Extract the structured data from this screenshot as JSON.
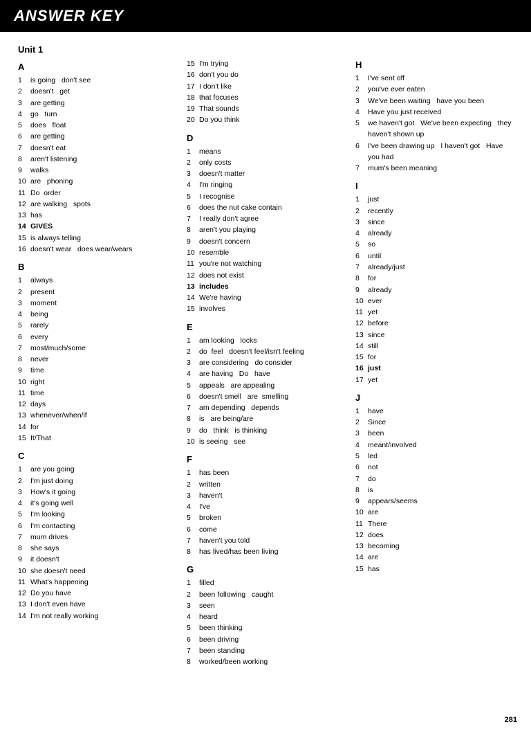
{
  "header": {
    "title": "ANSWER KEY"
  },
  "page_number": "281",
  "unit1": "Unit 1",
  "sections": {
    "A": {
      "label": "A",
      "items": [
        {
          "num": "1",
          "bold": false,
          "text": "is going   don't see"
        },
        {
          "num": "2",
          "bold": false,
          "text": "doesn't   get"
        },
        {
          "num": "3",
          "bold": false,
          "text": "are getting"
        },
        {
          "num": "4",
          "bold": false,
          "text": "go   turn"
        },
        {
          "num": "5",
          "bold": false,
          "text": "does   float"
        },
        {
          "num": "6",
          "bold": false,
          "text": "are getting"
        },
        {
          "num": "7",
          "bold": false,
          "text": "doesn't eat"
        },
        {
          "num": "8",
          "bold": false,
          "text": "aren't listening"
        },
        {
          "num": "9",
          "bold": false,
          "text": "walks"
        },
        {
          "num": "10",
          "bold": false,
          "text": "are   phoning"
        },
        {
          "num": "11",
          "bold": false,
          "text": "Do  order"
        },
        {
          "num": "12",
          "bold": false,
          "text": "are walking   spots"
        },
        {
          "num": "13",
          "bold": false,
          "text": "has"
        },
        {
          "num": "14",
          "bold": true,
          "text": "GIVES"
        },
        {
          "num": "15",
          "bold": false,
          "text": "is always telling"
        },
        {
          "num": "16",
          "bold": false,
          "text": "doesn't wear   does wear/wears"
        }
      ]
    },
    "B": {
      "label": "B",
      "items": [
        {
          "num": "1",
          "bold": false,
          "text": "always"
        },
        {
          "num": "2",
          "bold": false,
          "text": "present"
        },
        {
          "num": "3",
          "bold": false,
          "text": "moment"
        },
        {
          "num": "4",
          "bold": false,
          "text": "being"
        },
        {
          "num": "5",
          "bold": false,
          "text": "rarely"
        },
        {
          "num": "6",
          "bold": false,
          "text": "every"
        },
        {
          "num": "7",
          "bold": false,
          "text": "most/much/some"
        },
        {
          "num": "8",
          "bold": false,
          "text": "never"
        },
        {
          "num": "9",
          "bold": false,
          "text": "time"
        },
        {
          "num": "10",
          "bold": false,
          "text": "right"
        },
        {
          "num": "11",
          "bold": false,
          "text": "time"
        },
        {
          "num": "12",
          "bold": false,
          "text": "days"
        },
        {
          "num": "13",
          "bold": false,
          "text": "whenever/when/if"
        },
        {
          "num": "14",
          "bold": false,
          "text": "for"
        },
        {
          "num": "15",
          "bold": false,
          "text": "It/That"
        }
      ]
    },
    "C": {
      "label": "C",
      "items": [
        {
          "num": "1",
          "bold": false,
          "text": "are you going"
        },
        {
          "num": "2",
          "bold": false,
          "text": "I'm just doing"
        },
        {
          "num": "3",
          "bold": false,
          "text": "How's it going"
        },
        {
          "num": "4",
          "bold": false,
          "text": "it's going well"
        },
        {
          "num": "5",
          "bold": false,
          "text": "I'm looking"
        },
        {
          "num": "6",
          "bold": false,
          "text": "I'm contacting"
        },
        {
          "num": "7",
          "bold": false,
          "text": "mum drives"
        },
        {
          "num": "8",
          "bold": false,
          "text": "she says"
        },
        {
          "num": "9",
          "bold": false,
          "text": "it doesn't"
        },
        {
          "num": "10",
          "bold": false,
          "text": "she doesn't need"
        },
        {
          "num": "11",
          "bold": false,
          "text": "What's happening"
        },
        {
          "num": "12",
          "bold": false,
          "text": "Do you have"
        },
        {
          "num": "13",
          "bold": false,
          "text": "I don't even have"
        },
        {
          "num": "14",
          "bold": false,
          "text": "I'm not really working"
        }
      ]
    },
    "A2": {
      "label": "A",
      "col": 2,
      "items": [
        {
          "num": "15",
          "bold": false,
          "text": "I'm trying"
        },
        {
          "num": "16",
          "bold": false,
          "text": "don't you do"
        },
        {
          "num": "17",
          "bold": false,
          "text": "I don't like"
        },
        {
          "num": "18",
          "bold": false,
          "text": "that focuses"
        },
        {
          "num": "19",
          "bold": false,
          "text": "That sounds"
        },
        {
          "num": "20",
          "bold": false,
          "text": "Do you think"
        }
      ]
    },
    "D": {
      "label": "D",
      "items": [
        {
          "num": "1",
          "bold": false,
          "text": "means"
        },
        {
          "num": "2",
          "bold": false,
          "text": "only costs"
        },
        {
          "num": "3",
          "bold": false,
          "text": "doesn't matter"
        },
        {
          "num": "4",
          "bold": false,
          "text": "I'm ringing"
        },
        {
          "num": "5",
          "bold": false,
          "text": "I recognise"
        },
        {
          "num": "6",
          "bold": false,
          "text": "does the nut cake contain"
        },
        {
          "num": "7",
          "bold": false,
          "text": "I really don't agree"
        },
        {
          "num": "8",
          "bold": false,
          "text": "aren't you playing"
        },
        {
          "num": "9",
          "bold": false,
          "text": "doesn't concern"
        },
        {
          "num": "10",
          "bold": false,
          "text": "resemble"
        },
        {
          "num": "11",
          "bold": false,
          "text": "you're not watching"
        },
        {
          "num": "12",
          "bold": false,
          "text": "does not exist"
        },
        {
          "num": "13",
          "bold": true,
          "text": "includes"
        },
        {
          "num": "14",
          "bold": false,
          "text": "We're having"
        },
        {
          "num": "15",
          "bold": false,
          "text": "involves"
        }
      ]
    },
    "E": {
      "label": "E",
      "items": [
        {
          "num": "1",
          "bold": false,
          "text": "am looking   locks"
        },
        {
          "num": "2",
          "bold": false,
          "text": "do  feel   doesn't feel/isn't feeling"
        },
        {
          "num": "3",
          "bold": false,
          "text": "are considering   do consider"
        },
        {
          "num": "4",
          "bold": false,
          "text": "are having   Do   have"
        },
        {
          "num": "5",
          "bold": false,
          "text": "appeals   are appealing"
        },
        {
          "num": "6",
          "bold": false,
          "text": "doesn't smell   are  smelling"
        },
        {
          "num": "7",
          "bold": false,
          "text": "am depending   depends"
        },
        {
          "num": "8",
          "bold": false,
          "text": "is   are being/are"
        },
        {
          "num": "9",
          "bold": false,
          "text": "do   think   is thinking"
        },
        {
          "num": "10",
          "bold": false,
          "text": "is seeing   see"
        }
      ]
    },
    "F": {
      "label": "F",
      "items": [
        {
          "num": "1",
          "bold": false,
          "text": "has been"
        },
        {
          "num": "2",
          "bold": false,
          "text": "written"
        },
        {
          "num": "3",
          "bold": false,
          "text": "haven't"
        },
        {
          "num": "4",
          "bold": false,
          "text": "I've"
        },
        {
          "num": "5",
          "bold": false,
          "text": "broken"
        },
        {
          "num": "6",
          "bold": false,
          "text": "come"
        },
        {
          "num": "7",
          "bold": false,
          "text": "haven't you told"
        },
        {
          "num": "8",
          "bold": false,
          "text": "has lived/has been living"
        }
      ]
    },
    "G": {
      "label": "G",
      "items": [
        {
          "num": "1",
          "bold": false,
          "text": "filled"
        },
        {
          "num": "2",
          "bold": false,
          "text": "been following   caught"
        },
        {
          "num": "3",
          "bold": false,
          "text": "seen"
        },
        {
          "num": "4",
          "bold": false,
          "text": "heard"
        },
        {
          "num": "5",
          "bold": false,
          "text": "been thinking"
        },
        {
          "num": "6",
          "bold": false,
          "text": "been driving"
        },
        {
          "num": "7",
          "bold": false,
          "text": "been standing"
        },
        {
          "num": "8",
          "bold": false,
          "text": "worked/been working"
        }
      ]
    },
    "H": {
      "label": "H",
      "items": [
        {
          "num": "1",
          "bold": false,
          "text": "I've sent off"
        },
        {
          "num": "2",
          "bold": false,
          "text": "you've ever eaten"
        },
        {
          "num": "3",
          "bold": false,
          "text": "We've been waiting   have you been"
        },
        {
          "num": "4",
          "bold": false,
          "text": "Have you just received"
        },
        {
          "num": "5",
          "bold": false,
          "text": "we haven't got   We've been expecting   they haven't shown up"
        },
        {
          "num": "6",
          "bold": false,
          "text": "I've been drawing up   I haven't got   Have you had"
        },
        {
          "num": "7",
          "bold": false,
          "text": "mum's been meaning"
        }
      ]
    },
    "I": {
      "label": "I",
      "items": [
        {
          "num": "1",
          "bold": false,
          "text": "just"
        },
        {
          "num": "2",
          "bold": false,
          "text": "recently"
        },
        {
          "num": "3",
          "bold": false,
          "text": "since"
        },
        {
          "num": "4",
          "bold": false,
          "text": "already"
        },
        {
          "num": "5",
          "bold": false,
          "text": "so"
        },
        {
          "num": "6",
          "bold": false,
          "text": "until"
        },
        {
          "num": "7",
          "bold": false,
          "text": "already/just"
        },
        {
          "num": "8",
          "bold": false,
          "text": "for"
        },
        {
          "num": "9",
          "bold": false,
          "text": "already"
        },
        {
          "num": "10",
          "bold": false,
          "text": "ever"
        },
        {
          "num": "11",
          "bold": false,
          "text": "yet"
        },
        {
          "num": "12",
          "bold": false,
          "text": "before"
        },
        {
          "num": "13",
          "bold": false,
          "text": "since"
        },
        {
          "num": "14",
          "bold": false,
          "text": "still"
        },
        {
          "num": "15",
          "bold": false,
          "text": "for"
        },
        {
          "num": "16",
          "bold": true,
          "text": "just"
        },
        {
          "num": "17",
          "bold": false,
          "text": "yet"
        }
      ]
    },
    "J": {
      "label": "J",
      "items": [
        {
          "num": "1",
          "bold": false,
          "text": "have"
        },
        {
          "num": "2",
          "bold": false,
          "text": "Since"
        },
        {
          "num": "3",
          "bold": false,
          "text": "been"
        },
        {
          "num": "4",
          "bold": false,
          "text": "meant/involved"
        },
        {
          "num": "5",
          "bold": false,
          "text": "led"
        },
        {
          "num": "6",
          "bold": false,
          "text": "not"
        },
        {
          "num": "7",
          "bold": false,
          "text": "do"
        },
        {
          "num": "8",
          "bold": false,
          "text": "is"
        },
        {
          "num": "9",
          "bold": false,
          "text": "appears/seems"
        },
        {
          "num": "10",
          "bold": false,
          "text": "are"
        },
        {
          "num": "11",
          "bold": false,
          "text": "There"
        },
        {
          "num": "12",
          "bold": false,
          "text": "does"
        },
        {
          "num": "13",
          "bold": false,
          "text": "becoming"
        },
        {
          "num": "14",
          "bold": false,
          "text": "are"
        },
        {
          "num": "15",
          "bold": false,
          "text": "has"
        }
      ]
    }
  }
}
